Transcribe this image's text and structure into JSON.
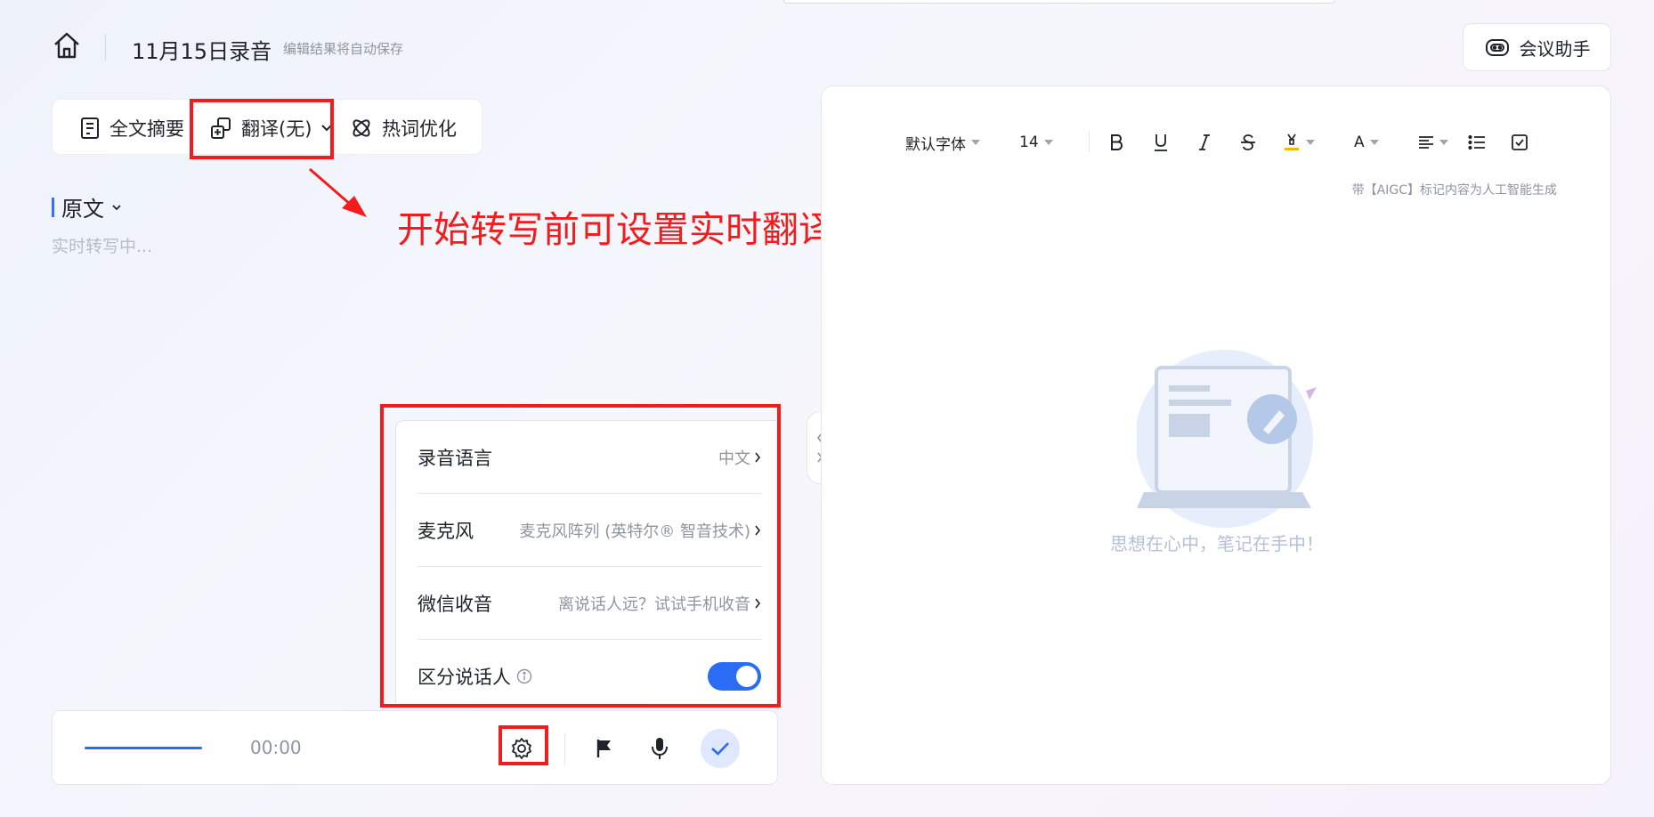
{
  "header": {
    "title": "11月15日录音",
    "subtitle": "编辑结果将自动保存",
    "assistant_label": "会议助手"
  },
  "toolbar": {
    "summary_label": "全文摘要",
    "translate_label": "翻译(无)",
    "hotword_label": "热词优化"
  },
  "transcript": {
    "section_label": "原文",
    "placeholder": "实时转写中..."
  },
  "annotation": {
    "text": "开始转写前可设置实时翻译",
    "color": "#f21c1c"
  },
  "settings_popup": {
    "rows": [
      {
        "label": "录音语言",
        "value": "中文"
      },
      {
        "label": "麦克风",
        "value": "麦克风阵列 (英特尔® 智音技术)"
      },
      {
        "label": "微信收音",
        "value": "离说话人远？试试手机收音"
      },
      {
        "label": "区分说话人",
        "toggle": true
      }
    ]
  },
  "recorder": {
    "time": "00:00",
    "accent_color": "#2b6cf5"
  },
  "editor": {
    "font_family_label": "默认字体",
    "font_size_label": "14",
    "aigc_note": "带【AIGC】标记内容为人工智能生成",
    "empty_text": "思想在心中，笔记在手中！",
    "text_color_label": "A"
  }
}
